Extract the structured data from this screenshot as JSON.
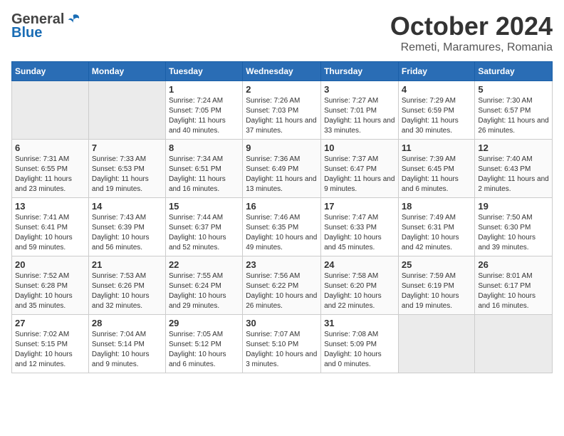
{
  "header": {
    "logo_general": "General",
    "logo_blue": "Blue",
    "month_title": "October 2024",
    "location": "Remeti, Maramures, Romania"
  },
  "weekdays": [
    "Sunday",
    "Monday",
    "Tuesday",
    "Wednesday",
    "Thursday",
    "Friday",
    "Saturday"
  ],
  "weeks": [
    [
      {
        "day": "",
        "empty": true
      },
      {
        "day": "",
        "empty": true
      },
      {
        "day": "1",
        "sunrise": "7:24 AM",
        "sunset": "7:05 PM",
        "daylight": "11 hours and 40 minutes."
      },
      {
        "day": "2",
        "sunrise": "7:26 AM",
        "sunset": "7:03 PM",
        "daylight": "11 hours and 37 minutes."
      },
      {
        "day": "3",
        "sunrise": "7:27 AM",
        "sunset": "7:01 PM",
        "daylight": "11 hours and 33 minutes."
      },
      {
        "day": "4",
        "sunrise": "7:29 AM",
        "sunset": "6:59 PM",
        "daylight": "11 hours and 30 minutes."
      },
      {
        "day": "5",
        "sunrise": "7:30 AM",
        "sunset": "6:57 PM",
        "daylight": "11 hours and 26 minutes."
      }
    ],
    [
      {
        "day": "6",
        "sunrise": "7:31 AM",
        "sunset": "6:55 PM",
        "daylight": "11 hours and 23 minutes."
      },
      {
        "day": "7",
        "sunrise": "7:33 AM",
        "sunset": "6:53 PM",
        "daylight": "11 hours and 19 minutes."
      },
      {
        "day": "8",
        "sunrise": "7:34 AM",
        "sunset": "6:51 PM",
        "daylight": "11 hours and 16 minutes."
      },
      {
        "day": "9",
        "sunrise": "7:36 AM",
        "sunset": "6:49 PM",
        "daylight": "11 hours and 13 minutes."
      },
      {
        "day": "10",
        "sunrise": "7:37 AM",
        "sunset": "6:47 PM",
        "daylight": "11 hours and 9 minutes."
      },
      {
        "day": "11",
        "sunrise": "7:39 AM",
        "sunset": "6:45 PM",
        "daylight": "11 hours and 6 minutes."
      },
      {
        "day": "12",
        "sunrise": "7:40 AM",
        "sunset": "6:43 PM",
        "daylight": "11 hours and 2 minutes."
      }
    ],
    [
      {
        "day": "13",
        "sunrise": "7:41 AM",
        "sunset": "6:41 PM",
        "daylight": "10 hours and 59 minutes."
      },
      {
        "day": "14",
        "sunrise": "7:43 AM",
        "sunset": "6:39 PM",
        "daylight": "10 hours and 56 minutes."
      },
      {
        "day": "15",
        "sunrise": "7:44 AM",
        "sunset": "6:37 PM",
        "daylight": "10 hours and 52 minutes."
      },
      {
        "day": "16",
        "sunrise": "7:46 AM",
        "sunset": "6:35 PM",
        "daylight": "10 hours and 49 minutes."
      },
      {
        "day": "17",
        "sunrise": "7:47 AM",
        "sunset": "6:33 PM",
        "daylight": "10 hours and 45 minutes."
      },
      {
        "day": "18",
        "sunrise": "7:49 AM",
        "sunset": "6:31 PM",
        "daylight": "10 hours and 42 minutes."
      },
      {
        "day": "19",
        "sunrise": "7:50 AM",
        "sunset": "6:30 PM",
        "daylight": "10 hours and 39 minutes."
      }
    ],
    [
      {
        "day": "20",
        "sunrise": "7:52 AM",
        "sunset": "6:28 PM",
        "daylight": "10 hours and 35 minutes."
      },
      {
        "day": "21",
        "sunrise": "7:53 AM",
        "sunset": "6:26 PM",
        "daylight": "10 hours and 32 minutes."
      },
      {
        "day": "22",
        "sunrise": "7:55 AM",
        "sunset": "6:24 PM",
        "daylight": "10 hours and 29 minutes."
      },
      {
        "day": "23",
        "sunrise": "7:56 AM",
        "sunset": "6:22 PM",
        "daylight": "10 hours and 26 minutes."
      },
      {
        "day": "24",
        "sunrise": "7:58 AM",
        "sunset": "6:20 PM",
        "daylight": "10 hours and 22 minutes."
      },
      {
        "day": "25",
        "sunrise": "7:59 AM",
        "sunset": "6:19 PM",
        "daylight": "10 hours and 19 minutes."
      },
      {
        "day": "26",
        "sunrise": "8:01 AM",
        "sunset": "6:17 PM",
        "daylight": "10 hours and 16 minutes."
      }
    ],
    [
      {
        "day": "27",
        "sunrise": "7:02 AM",
        "sunset": "5:15 PM",
        "daylight": "10 hours and 12 minutes."
      },
      {
        "day": "28",
        "sunrise": "7:04 AM",
        "sunset": "5:14 PM",
        "daylight": "10 hours and 9 minutes."
      },
      {
        "day": "29",
        "sunrise": "7:05 AM",
        "sunset": "5:12 PM",
        "daylight": "10 hours and 6 minutes."
      },
      {
        "day": "30",
        "sunrise": "7:07 AM",
        "sunset": "5:10 PM",
        "daylight": "10 hours and 3 minutes."
      },
      {
        "day": "31",
        "sunrise": "7:08 AM",
        "sunset": "5:09 PM",
        "daylight": "10 hours and 0 minutes."
      },
      {
        "day": "",
        "empty": true
      },
      {
        "day": "",
        "empty": true
      }
    ]
  ],
  "labels": {
    "sunrise": "Sunrise:",
    "sunset": "Sunset:",
    "daylight": "Daylight:"
  }
}
